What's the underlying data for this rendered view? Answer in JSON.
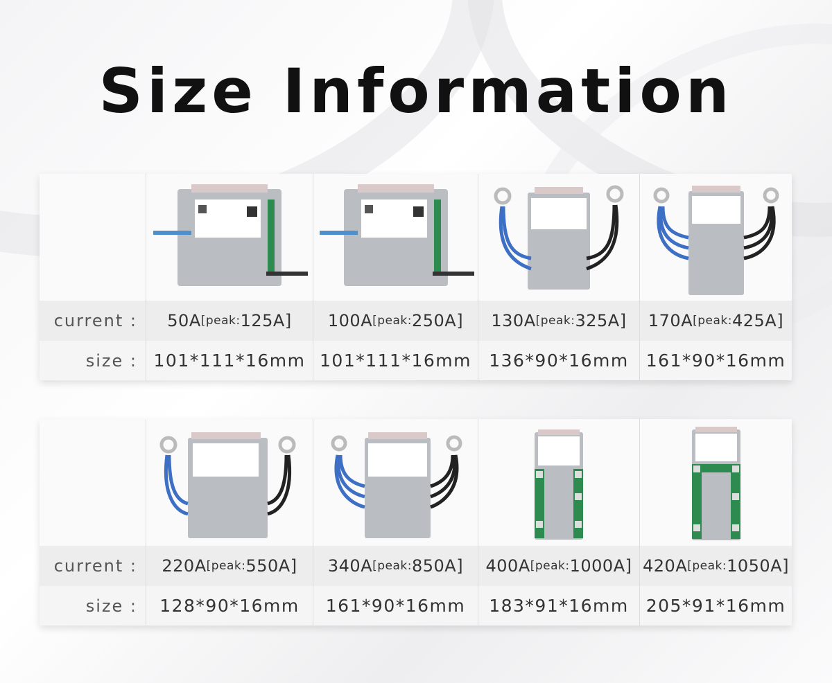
{
  "title": "Size Information",
  "labels": {
    "current": "current  :",
    "size": "size  :"
  },
  "colors": {
    "board": "#b9bdc2",
    "pcb": "#2e8b50",
    "cable_blue": "#3d6fc4",
    "cable_black": "#222222"
  },
  "products": [
    {
      "amp": "50A",
      "peak_open": "[peak:",
      "peak_val": "125A]",
      "size": "101*111*16mm",
      "terminal": "wire-leads"
    },
    {
      "amp": "100A",
      "peak_open": "[peak:",
      "peak_val": "250A]",
      "size": "101*111*16mm",
      "terminal": "wire-leads"
    },
    {
      "amp": "130A",
      "peak_open": "[peak:",
      "peak_val": "325A]",
      "size": "136*90*16mm",
      "terminal": "ring-cables"
    },
    {
      "amp": "170A",
      "peak_open": "[peak:",
      "peak_val": "425A]",
      "size": "161*90*16mm",
      "terminal": "ring-cables"
    },
    {
      "amp": "220A",
      "peak_open": "[peak:",
      "peak_val": "550A]",
      "size": "128*90*16mm",
      "terminal": "ring-cables"
    },
    {
      "amp": "340A",
      "peak_open": "[peak:",
      "peak_val": "850A]",
      "size": "161*90*16mm",
      "terminal": "ring-cables"
    },
    {
      "amp": "400A",
      "peak_open": "[peak:",
      "peak_val": "1000A]",
      "size": "183*91*16mm",
      "terminal": "bolt-pads"
    },
    {
      "amp": "420A",
      "peak_open": "[peak:",
      "peak_val": "1050A]",
      "size": "205*91*16mm",
      "terminal": "bolt-pads"
    }
  ]
}
